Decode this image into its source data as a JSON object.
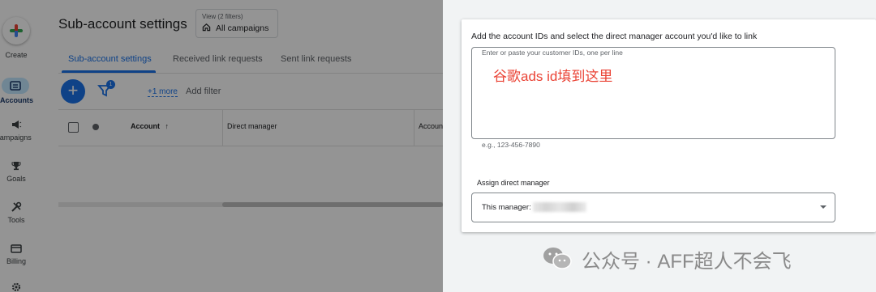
{
  "nav": {
    "items": [
      {
        "label": "Create",
        "icon": "plus-icon"
      },
      {
        "label": "Accounts",
        "icon": "accounts-icon"
      },
      {
        "label": "Campaigns",
        "icon": "megaphone-icon"
      },
      {
        "label": "Goals",
        "icon": "trophy-icon"
      },
      {
        "label": "Tools",
        "icon": "tools-icon"
      },
      {
        "label": "Billing",
        "icon": "card-icon"
      }
    ]
  },
  "header": {
    "title": "Sub-account settings",
    "view_chip": {
      "small": "View (2 filters)",
      "main": "All campaigns"
    }
  },
  "tabs": [
    {
      "label": "Sub-account settings",
      "active": true
    },
    {
      "label": "Received link requests",
      "active": false
    },
    {
      "label": "Sent link requests",
      "active": false
    }
  ],
  "toolbar": {
    "filter_count": "1",
    "more_link": "+1 more",
    "add_filter": "Add filter"
  },
  "table": {
    "columns": [
      "Account",
      "Direct manager",
      "Accoun"
    ]
  },
  "panel": {
    "instruction": "Add the account IDs and select the direct manager account you'd like to link",
    "textarea_label": "Enter or paste your customer IDs, one per line",
    "annotation": "谷歌ads id填到这里",
    "hint": "e.g., 123-456-7890",
    "assign_label": "Assign direct manager",
    "select_value": "This manager:"
  },
  "watermark": {
    "text": "公众号 · AFF超人不会飞"
  },
  "colors": {
    "accent": "#1a73e8",
    "annotation": "#ea4335",
    "scrim": "rgba(0,0,0,0.42)"
  }
}
